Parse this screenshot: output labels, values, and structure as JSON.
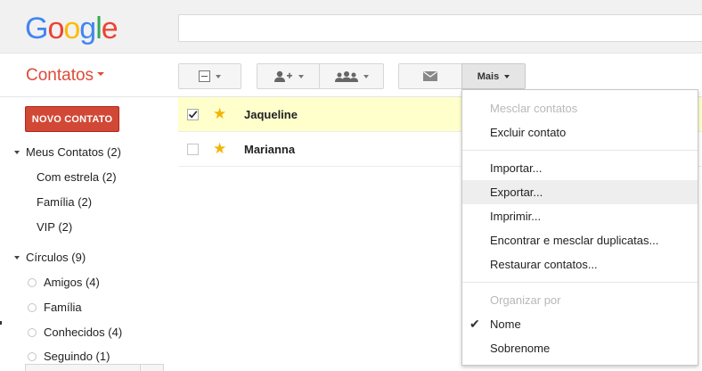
{
  "logo": {
    "letters": [
      "G",
      "o",
      "o",
      "g",
      "l",
      "e"
    ],
    "colors": [
      "#4285f4",
      "#ea4335",
      "#fbbc05",
      "#4285f4",
      "#34a853",
      "#ea4335"
    ]
  },
  "search": {
    "value": "",
    "placeholder": ""
  },
  "app": {
    "title": "Contatos"
  },
  "toolbar": {
    "select_icon": "select-all-checkbox-icon",
    "add_contact_icon": "add-person-icon",
    "circles_icon": "group-people-icon",
    "email_icon": "envelope-icon",
    "more_label": "Mais"
  },
  "sidebar": {
    "new_contact_label": "NOVO CONTATO",
    "my_contacts": "Meus Contatos (2)",
    "starred": "Com estrela (2)",
    "family": "Família (2)",
    "vip": "VIP (2)",
    "circles": "Círculos (9)",
    "friends": "Amigos (4)",
    "family_circle": "Família",
    "acquaintances": "Conhecidos (4)",
    "following": "Seguindo (1)"
  },
  "contacts": [
    {
      "name": "Jaqueline",
      "checked": true,
      "starred": true
    },
    {
      "name": "Marianna",
      "checked": false,
      "starred": true
    }
  ],
  "menu": {
    "merge": "Mesclar contatos",
    "delete": "Excluir contato",
    "import": "Importar...",
    "export": "Exportar...",
    "print": "Imprimir...",
    "find_merge": "Encontrar e mesclar duplicatas...",
    "restore": "Restaurar contatos...",
    "sort_by": "Organizar por",
    "sort_name": "Nome",
    "sort_surname": "Sobrenome"
  },
  "colors": {
    "accent_red": "#dd4b39",
    "button_red": "#d14836",
    "selected_row": "#ffffcc",
    "star": "#f4b400"
  }
}
